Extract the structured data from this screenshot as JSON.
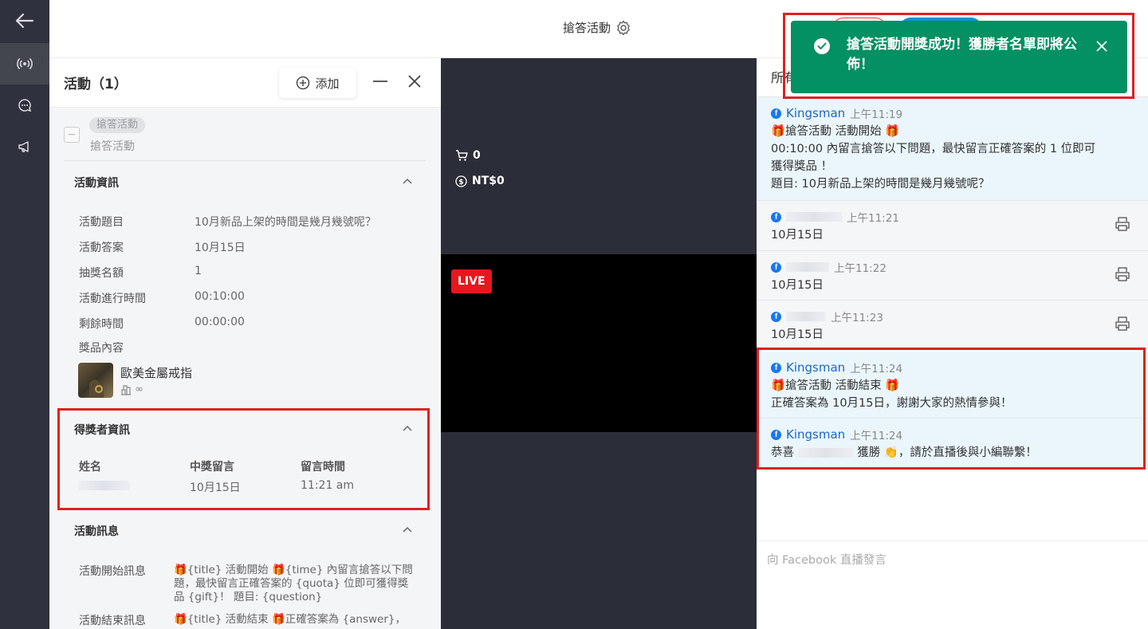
{
  "header": {
    "title": "搶答活動"
  },
  "left_panel": {
    "title": "活動（1）",
    "add_label": "添加",
    "activity": {
      "badge": "搶答活動",
      "subtitle": "搶答活動"
    },
    "info_section": {
      "title": "活動資訊",
      "rows": [
        {
          "label": "活動題目",
          "value": "10月新品上架的時間是幾月幾號呢？"
        },
        {
          "label": "活動答案",
          "value": "10月15日"
        },
        {
          "label": "抽獎名額",
          "value": "1"
        },
        {
          "label": "活動進行時間",
          "value": "00:10:00"
        },
        {
          "label": "剩餘時間",
          "value": "00:00:00"
        }
      ],
      "prize_label": "獎品內容",
      "prize_name": "歐美金屬戒指",
      "prize_qty": "∞"
    },
    "winner_section": {
      "title": "得獎者資訊",
      "columns": [
        "姓名",
        "中獎留言",
        "留言時間"
      ],
      "row": {
        "comment": "10月15日",
        "time": "11:21 am"
      }
    },
    "message_section": {
      "title": "活動訊息",
      "rows": [
        {
          "label": "活動開始訊息",
          "value": "🎁{title} 活動開始 🎁{time} 內留言搶答以下問題，最快留言正確答案的 {quota} 位即可獲得獎品 {gift}！ 題目: {question}"
        },
        {
          "label": "活動結束訊息",
          "value": "🎁{title} 活動結束 🎁正確答案為 {answer}，"
        }
      ]
    }
  },
  "video": {
    "cart_count": "0",
    "amount": "NT$0",
    "live_label": "LIVE"
  },
  "right_panel": {
    "header_partial": "所有",
    "comments": [
      {
        "name": "Kingsman",
        "time": "上午11:19",
        "lines": [
          "🎁搶答活動 活動開始 🎁",
          "00:10:00 內留言搶答以下問題，最快留言正確答案的 1 位即可獲得獎品 ！",
          "題目: 10月新品上架的時間是幾月幾號呢？"
        ]
      },
      {
        "name": "",
        "time": "上午11:21",
        "lines": [
          "10月15日"
        ]
      },
      {
        "name": "",
        "time": "上午11:22",
        "lines": [
          "10月15日"
        ]
      },
      {
        "name": "",
        "time": "上午11:23",
        "lines": [
          "10月15日"
        ]
      },
      {
        "name": "Kingsman",
        "time": "上午11:24",
        "lines": [
          "🎁搶答活動 活動結束 🎁",
          "正確答案為 10月15日，謝謝大家的熱情參與！"
        ]
      },
      {
        "name": "Kingsman",
        "time": "上午11:24",
        "lines_pre": "恭喜",
        "lines_post": "獲勝 👏，請於直播後與小編聯繫！"
      }
    ],
    "input_placeholder": "向 Facebook 直播發言"
  },
  "toast": {
    "message": "搶答活動開獎成功！獲勝者名單即將公佈！"
  },
  "colors": {
    "toast_bg": "#039062",
    "highlight_red": "#e02020",
    "live_red": "#e5181d",
    "fb_blue": "#1877f2"
  }
}
